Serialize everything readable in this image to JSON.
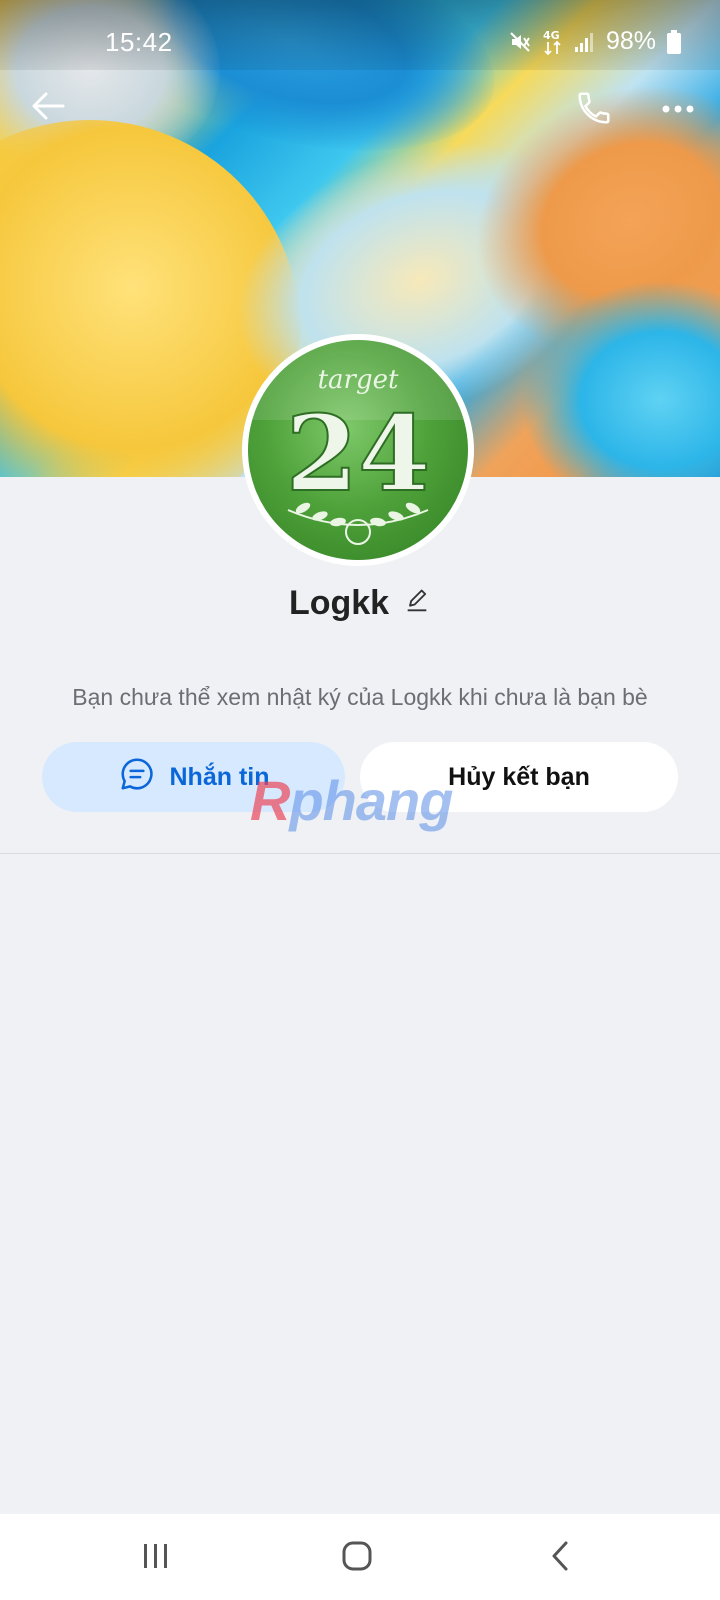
{
  "status_bar": {
    "time": "15:42",
    "network": "4G",
    "battery": "98%",
    "icons": [
      "mute-icon",
      "network-4g-icon",
      "signal-icon",
      "battery-icon"
    ]
  },
  "header": {
    "icons": [
      "back-arrow-icon",
      "phone-icon",
      "more-dots-icon"
    ]
  },
  "cover": {
    "description_colors": [
      "#f5c63a",
      "#1aa3de",
      "#f29a4c"
    ]
  },
  "avatar": {
    "logo_text_top": "target",
    "logo_number": "24"
  },
  "profile": {
    "name": "Logkk",
    "notice": "Bạn chưa thể xem nhật ký của Logkk khi chưa là bạn bè"
  },
  "actions": {
    "message_label": "Nhắn tin",
    "unfriend_label": "Hủy kết bạn"
  },
  "watermark": {
    "first": "R",
    "rest": "phang"
  },
  "colors": {
    "accent": "#0b66d9",
    "message_bg": "#d6e9ff",
    "page_bg": "#eff1f5"
  },
  "nav_bar": {
    "icons": [
      "recent-apps-icon",
      "home-icon",
      "system-back-icon"
    ]
  }
}
